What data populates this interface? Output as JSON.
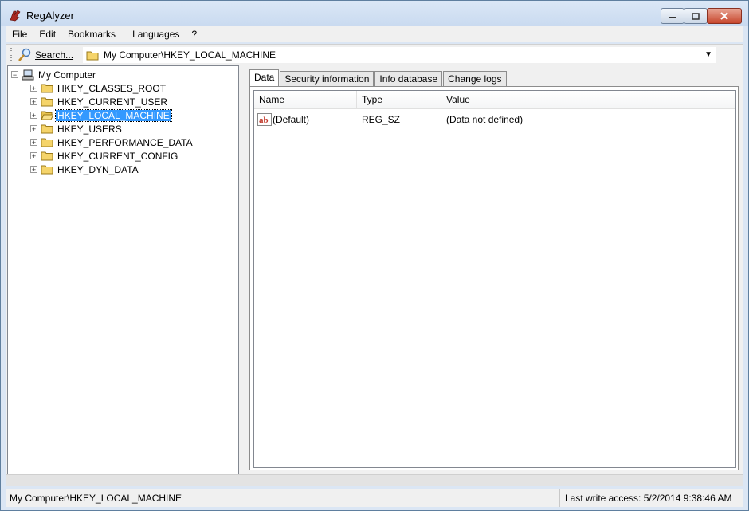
{
  "window": {
    "title": "RegAlyzer"
  },
  "menu": {
    "items": [
      "File",
      "Edit",
      "Bookmarks",
      "Languages",
      "?"
    ]
  },
  "toolbar": {
    "search_label": "Search...",
    "address": "My Computer\\HKEY_LOCAL_MACHINE"
  },
  "tree": {
    "root": "My Computer",
    "children": [
      "HKEY_CLASSES_ROOT",
      "HKEY_CURRENT_USER",
      "HKEY_LOCAL_MACHINE",
      "HKEY_USERS",
      "HKEY_PERFORMANCE_DATA",
      "HKEY_CURRENT_CONFIG",
      "HKEY_DYN_DATA"
    ],
    "selected": "HKEY_LOCAL_MACHINE"
  },
  "tabs": [
    "Data",
    "Security information",
    "Info database",
    "Change logs"
  ],
  "list": {
    "columns": [
      "Name",
      "Type",
      "Value"
    ],
    "rows": [
      {
        "name": "(Default)",
        "type": "REG_SZ",
        "value": "(Data not defined)"
      }
    ]
  },
  "status": {
    "path": "My Computer\\HKEY_LOCAL_MACHINE",
    "last_write": "Last write access: 5/2/2014 9:38:46 AM"
  },
  "colors": {
    "selection": "#3399ff",
    "folder": "#f5d46a"
  }
}
